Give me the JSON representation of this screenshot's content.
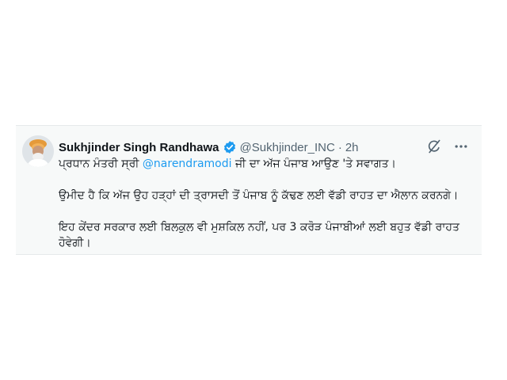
{
  "tweet": {
    "author_name": "Sukhjinder Singh Randhawa",
    "handle": "@Sukhjinder_INC",
    "separator": "·",
    "time": "2h",
    "verified_color": "#1d9bf0",
    "icons": {
      "avatar": "avatar-photo",
      "verified": "verified-badge-icon",
      "grok": "grok-icon",
      "more": "more-icon"
    },
    "paragraph1": {
      "prefix": "ਪ੍ਰਧਾਨ ਮੰਤਰੀ ਸ੍ਰੀ ",
      "mention": "@narendramodi",
      "suffix": " ਜੀ ਦਾ ਅੱਜ ਪੰਜਾਬ ਆਉਣ 'ਤੇ ਸਵਾਗਤ।"
    },
    "paragraph2": "ਉਮੀਦ ਹੈ ਕਿ ਅੱਜ ਉਹ ਹੜ੍ਹਾਂ ਦੀ ਤ੍ਰਾਸਦੀ ਤੋਂ ਪੰਜਾਬ ਨੂੰ ਕੱਢਣ ਲਈ ਵੱਡੀ ਰਾਹਤ ਦਾ ਐਲਾਨ ਕਰਨਗੇ।",
    "paragraph3": "ਇਹ ਕੇਂਦਰ ਸਰਕਾਰ ਲਈ ਬਿਲਕੁਲ ਵੀ ਮੁਸ਼ਕਿਲ ਨਹੀਂ, ਪਰ 3 ਕਰੋੜ ਪੰਜਾਬੀਆਂ ਲਈ ਬਹੁਤ ਵੱਡੀ ਰਾਹਤ ਹੋਵੇਗੀ।"
  }
}
